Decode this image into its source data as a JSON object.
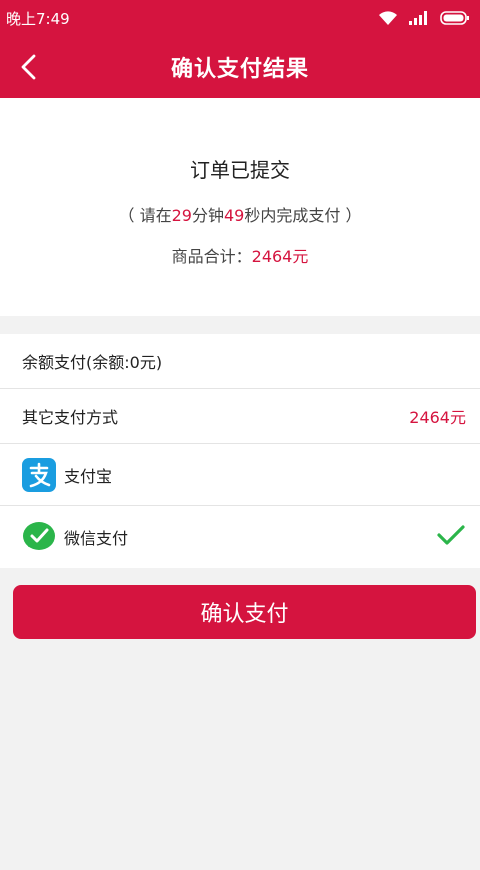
{
  "status_bar": {
    "time": "晚上7:49"
  },
  "header": {
    "title": "确认支付结果"
  },
  "order": {
    "status": "订单已提交",
    "countdown": {
      "prefix": "（ 请在",
      "minutes": "29",
      "min_unit": "分钟",
      "seconds": "49",
      "suffix": "秒内完成支付 ）"
    },
    "total_label": "商品合计：",
    "total_value": "2464元"
  },
  "payment": {
    "balance_label": "余额支付(余额:0元)",
    "other_label": "其它支付方式",
    "other_amount": "2464元",
    "alipay_label": "支付宝",
    "wechat_label": "微信支付",
    "selected": "wechat"
  },
  "confirm_button": {
    "label": "确认支付"
  },
  "colors": {
    "accent": "#d5143f",
    "alipay": "#1a9de0",
    "wechat": "#2bb54a"
  }
}
